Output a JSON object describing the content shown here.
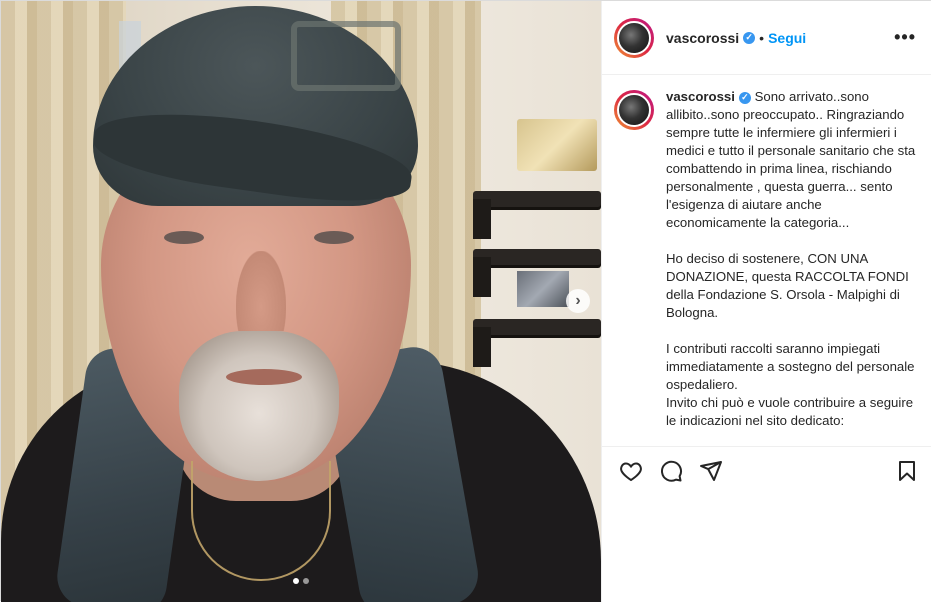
{
  "post": {
    "username": "vascorossi",
    "follow_label": "Segui",
    "separator": "•",
    "more_label": "•••",
    "verified_glyph": "✓"
  },
  "caption": {
    "username": "vascorossi",
    "paragraph1": "Sono arrivato..sono allibito..sono preoccupato.. Ringraziando sempre tutte le infermiere gli infermieri i medici e tutto il personale sanitario che sta combattendo in prima linea, rischiando personalmente , questa guerra... sento l'esigenza di aiutare anche economicamente la categoria...",
    "paragraph2": "Ho deciso di sostenere, CON UNA DONAZIONE, questa RACCOLTA FONDI della Fondazione S. Orsola - Malpighi di Bologna.",
    "paragraph3": "I contributi raccolti saranno impiegati immediatamente a sostegno del personale ospedaliero.\nInvito chi può e vuole contribuire a seguire le indicazioni nel sito dedicato:"
  },
  "media": {
    "next_glyph": "›",
    "carousel_total": 2,
    "carousel_active": 1
  },
  "icons": {
    "like": "heart-icon",
    "comment": "comment-icon",
    "share": "paper-plane-icon",
    "save": "bookmark-icon",
    "next": "chevron-right-icon"
  },
  "colors": {
    "accent": "#0095f6",
    "verified": "#3897f0",
    "text": "#262626",
    "border": "#efefef"
  }
}
